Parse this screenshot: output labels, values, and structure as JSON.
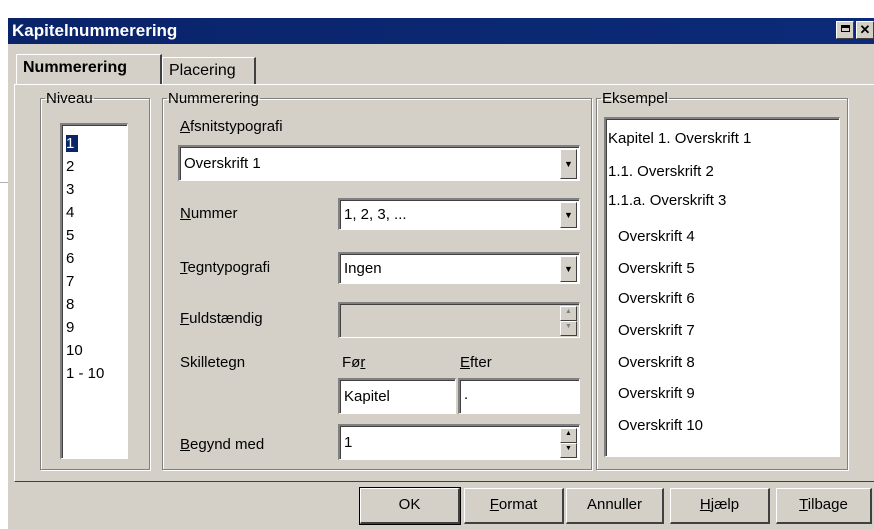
{
  "window": {
    "title": "Kapitelnummerering"
  },
  "tabs": [
    {
      "label": "Nummerering"
    },
    {
      "label": "Placering"
    }
  ],
  "niveau": {
    "legend": "Niveau",
    "items": [
      "1",
      "2",
      "3",
      "4",
      "5",
      "6",
      "7",
      "8",
      "9",
      "10",
      "1 - 10"
    ],
    "selected": "1"
  },
  "nummerering": {
    "legend": "Nummerering",
    "afsnit_label_first": "A",
    "afsnit_label_rest": "fsnitstypografi",
    "afsnit_value": "Overskrift 1",
    "nummer_label_first": "N",
    "nummer_label_rest": "ummer",
    "nummer_value": "1, 2, 3, ...",
    "tegn_label_first": "T",
    "tegn_label_rest": "egntypografi",
    "tegn_value": "Ingen",
    "fuld_label_first": "F",
    "fuld_label_rest": "uldstændig",
    "fuld_value": "",
    "skilletegn_label": "Skilletegn",
    "foer_label_first": "Fø",
    "foer_label_acc": "r",
    "efter_label_first": "E",
    "efter_label_rest": "fter",
    "foer_value": "Kapitel",
    "efter_value": ".",
    "begynd_label_first": "B",
    "begynd_label_rest": "egynd med",
    "begynd_value": "1"
  },
  "eksempel": {
    "legend": "Eksempel",
    "lines": [
      "Kapitel 1.  Overskrift 1",
      "1.1.  Overskrift 2",
      "1.1.a.  Overskrift 3",
      "Overskrift 4",
      "Overskrift 5",
      "Overskrift 6",
      "Overskrift 7",
      "Overskrift 8",
      "Overskrift 9",
      "Overskrift 10"
    ]
  },
  "buttons": {
    "ok": "OK",
    "format_first": "F",
    "format_rest": "ormat",
    "annuller": "Annuller",
    "hjaelp_first": "H",
    "hjaelp_rest": "jælp",
    "tilbage_first": "T",
    "tilbage_rest": "ilbage"
  },
  "titlebar_icons": [
    "maximize-icon",
    "close-icon"
  ]
}
